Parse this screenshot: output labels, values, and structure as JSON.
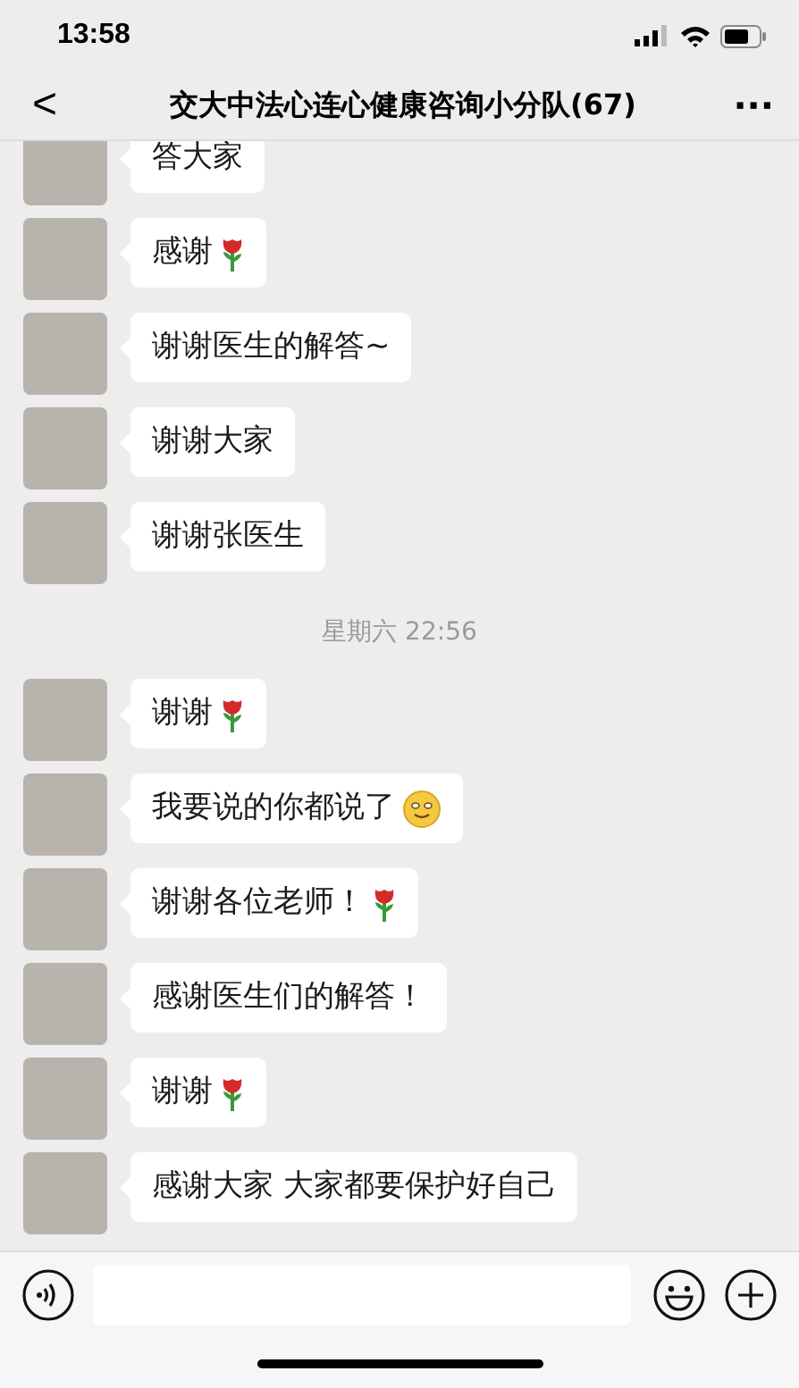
{
  "status_bar": {
    "time": "13:58"
  },
  "nav": {
    "back": "<",
    "title": "交大中法心连心健康咨询小分队(67)",
    "more": "···"
  },
  "messages": [
    {
      "kind": "message",
      "text": "答大家"
    },
    {
      "kind": "message",
      "text": "感谢",
      "emoji": {
        "kind": "rose"
      }
    },
    {
      "kind": "message",
      "text": "谢谢医生的解答~"
    },
    {
      "kind": "message",
      "text": "谢谢大家"
    },
    {
      "kind": "message",
      "text": "谢谢张医生"
    },
    {
      "kind": "time",
      "text": "星期六 22:56"
    },
    {
      "kind": "message",
      "text": "谢谢",
      "emoji": {
        "kind": "rose"
      }
    },
    {
      "kind": "message",
      "text": "我要说的你都说了",
      "emoji": {
        "kind": "smile"
      }
    },
    {
      "kind": "message",
      "text": "谢谢各位老师！",
      "emoji": {
        "kind": "rose"
      }
    },
    {
      "kind": "message",
      "text": "感谢医生们的解答！"
    },
    {
      "kind": "message",
      "text": "谢谢",
      "emoji": {
        "kind": "rose"
      }
    },
    {
      "kind": "message",
      "text": "感谢大家 大家都要保护好自己"
    }
  ]
}
